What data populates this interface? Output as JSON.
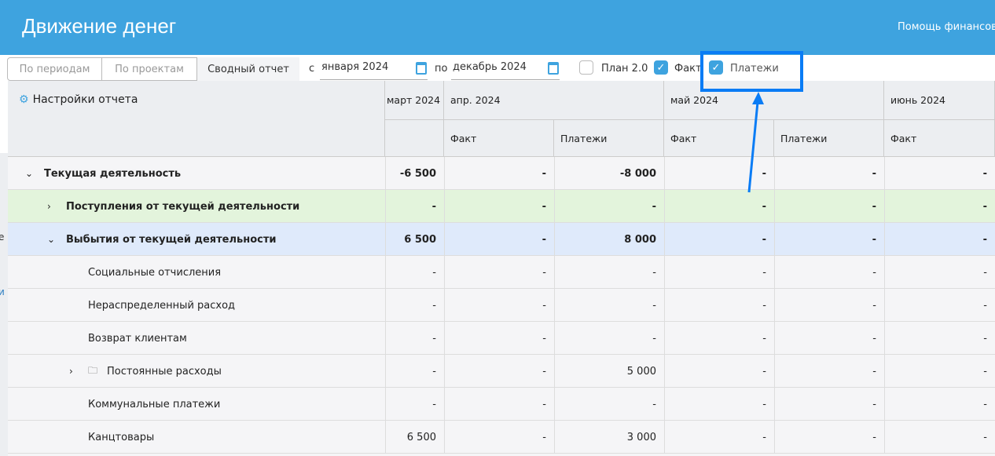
{
  "header": {
    "title": "Движение денег",
    "help": "Помощь финансов"
  },
  "toolbar": {
    "tabs": [
      "По периодам",
      "По проектам",
      "Сводный отчет"
    ],
    "from_label": "с",
    "from_value": "января 2024",
    "to_label": "по",
    "to_value": "декабрь 2024",
    "checkboxes": [
      {
        "label": "План 2.0",
        "checked": false
      },
      {
        "label": "Факт",
        "checked": true
      },
      {
        "label": "Платежи",
        "checked": true
      }
    ]
  },
  "left_fragments": [
    "е",
    "и"
  ],
  "table": {
    "settings_label": "Настройки отчета",
    "months": [
      "март 2024",
      "апр. 2024",
      "май 2024",
      "июнь 2024"
    ],
    "subheaders": [
      "",
      "Факт",
      "Платежи",
      "Факт",
      "Платежи",
      "Факт"
    ],
    "rows": [
      {
        "label": "Текущая деятельность",
        "level": 0,
        "toggle": "v",
        "bold": true,
        "values": [
          "-6 500",
          "-",
          "-8 000",
          "-",
          "-",
          "-"
        ]
      },
      {
        "label": "Поступления от текущей деятельности",
        "level": 1,
        "toggle": ">",
        "bold": true,
        "values": [
          "-",
          "-",
          "-",
          "-",
          "-",
          "-"
        ]
      },
      {
        "label": "Выбытия от текущей деятельности",
        "level": 1,
        "toggle": "v",
        "bold": true,
        "values": [
          "6 500",
          "-",
          "8 000",
          "-",
          "-",
          "-"
        ]
      },
      {
        "label": "Социальные отчисления",
        "level": 2,
        "values": [
          "-",
          "-",
          "-",
          "-",
          "-",
          "-"
        ]
      },
      {
        "label": "Нераспределенный расход",
        "level": 2,
        "values": [
          "-",
          "-",
          "-",
          "-",
          "-",
          "-"
        ]
      },
      {
        "label": "Возврат клиентам",
        "level": 2,
        "values": [
          "-",
          "-",
          "-",
          "-",
          "-",
          "-"
        ]
      },
      {
        "label": "Постоянные расходы",
        "level": 2,
        "toggle": ">",
        "folder": true,
        "values": [
          "-",
          "-",
          "5 000",
          "-",
          "-",
          "-"
        ]
      },
      {
        "label": "Коммунальные платежи",
        "level": 2,
        "values": [
          "-",
          "-",
          "-",
          "-",
          "-",
          "-"
        ]
      },
      {
        "label": "Канцтовары",
        "level": 2,
        "values": [
          "6 500",
          "-",
          "3 000",
          "-",
          "-",
          "-"
        ]
      }
    ]
  },
  "colors": {
    "header": "#3ea3df",
    "income_row": "#e3f4dc",
    "expense_row": "#dfeafb",
    "highlight": "#0a7cf5"
  }
}
